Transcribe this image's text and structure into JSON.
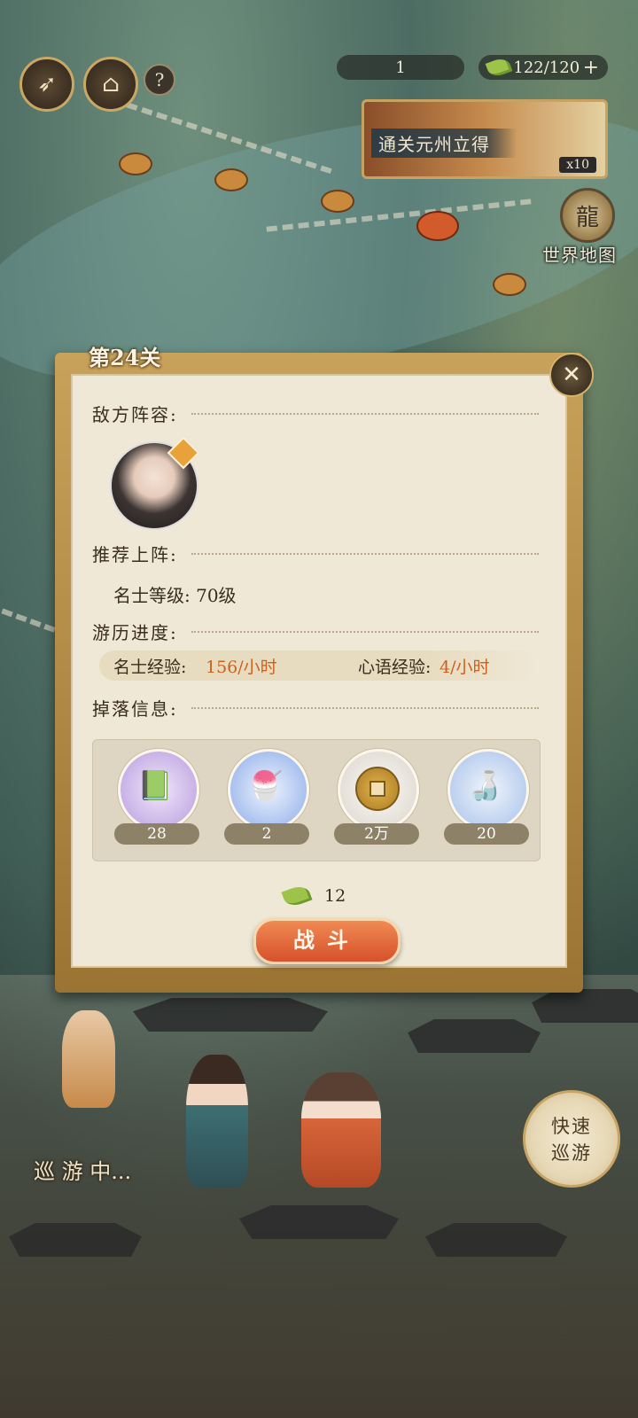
{
  "hud": {
    "level_value": "1",
    "stamina": "122/120",
    "plus_symbol": "+",
    "help_symbol": "?",
    "reward_banner_text": "通关元州立得",
    "reward_banner_count": "x10",
    "world_map_label": "世界地图"
  },
  "dialog": {
    "stage_title": "第24关",
    "enemy_section": "敌方阵容:",
    "recommend_section": "推荐上阵:",
    "recommend_level": "名士等级: 70级",
    "progress_section": "游历进度:",
    "exp_mingshi_label": "名士经验:",
    "exp_mingshi_value": "156/小时",
    "exp_xinyu_label": "心语经验:",
    "exp_xinyu_value": "4/小时",
    "drop_section": "掉落信息:",
    "drops": [
      {
        "icon": "book-icon",
        "count": "28",
        "color": "#c9b2e6"
      },
      {
        "icon": "dessert-icon",
        "count": "2",
        "color": "#a9c1ef"
      },
      {
        "icon": "coin-icon",
        "count": "2万",
        "color": "#e4e0d8"
      },
      {
        "icon": "teaset-icon",
        "count": "20",
        "color": "#bcd0ef"
      }
    ],
    "cost": "12",
    "fight_label": "战斗"
  },
  "scene": {
    "touring_text": "巡 游 中...",
    "quick_tour_line1": "快速",
    "quick_tour_line2": "巡游"
  },
  "colors": {
    "accent_gold": "#c9a866",
    "fight_button": "#d6512a",
    "exp_value": "#c9621f"
  }
}
